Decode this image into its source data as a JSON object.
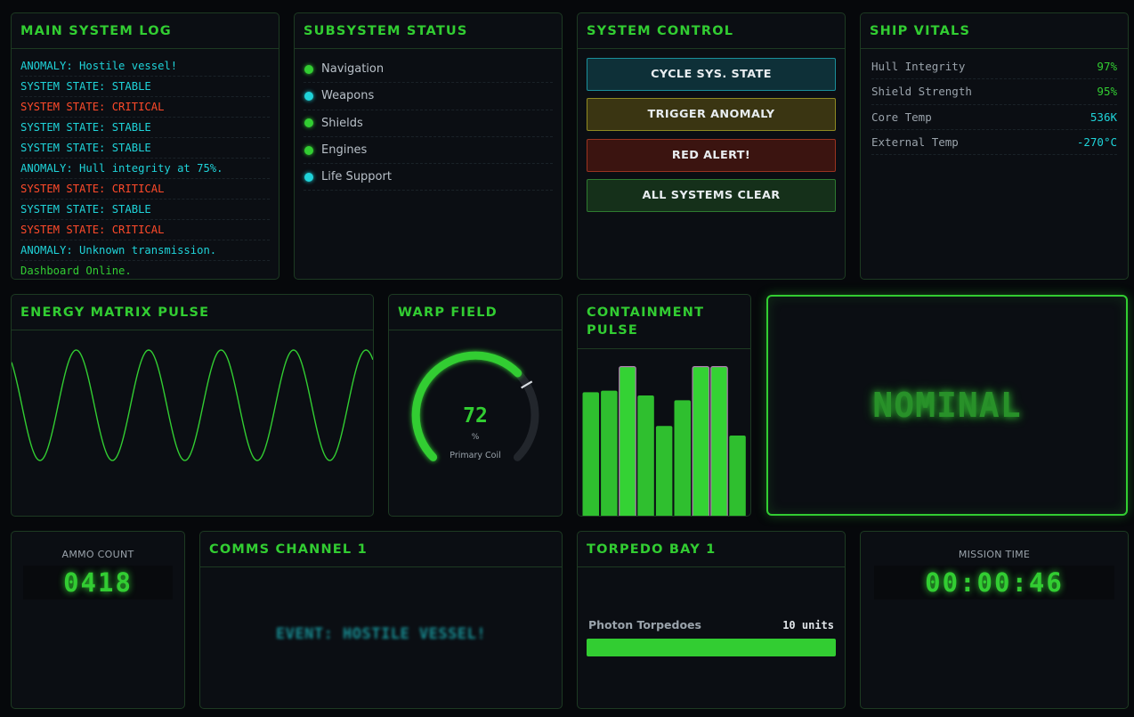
{
  "colors": {
    "accent": "#32cd32",
    "cyan": "#1fd3d9",
    "critical": "#ff4a2a"
  },
  "log": {
    "title": "MAIN SYSTEM LOG",
    "lines": [
      {
        "text": "ANOMALY: Hostile vessel!",
        "tone": "cyan"
      },
      {
        "text": "SYSTEM STATE: STABLE",
        "tone": "cyan"
      },
      {
        "text": "SYSTEM STATE: CRITICAL",
        "tone": "red"
      },
      {
        "text": "SYSTEM STATE: STABLE",
        "tone": "cyan"
      },
      {
        "text": "SYSTEM STATE: STABLE",
        "tone": "cyan"
      },
      {
        "text": "ANOMALY: Hull integrity at 75%.",
        "tone": "cyan"
      },
      {
        "text": "SYSTEM STATE: CRITICAL",
        "tone": "red"
      },
      {
        "text": "SYSTEM STATE: STABLE",
        "tone": "cyan"
      },
      {
        "text": "SYSTEM STATE: CRITICAL",
        "tone": "red"
      },
      {
        "text": "ANOMALY: Unknown transmission.",
        "tone": "cyan"
      },
      {
        "text": "Dashboard Online.",
        "tone": "green"
      }
    ]
  },
  "subsystems": {
    "title": "SUBSYSTEM STATUS",
    "items": [
      {
        "label": "Navigation",
        "status": "green"
      },
      {
        "label": "Weapons",
        "status": "cyan"
      },
      {
        "label": "Shields",
        "status": "green"
      },
      {
        "label": "Engines",
        "status": "green"
      },
      {
        "label": "Life Support",
        "status": "cyan"
      }
    ]
  },
  "control": {
    "title": "SYSTEM CONTROL",
    "cycle": "CYCLE SYS. STATE",
    "anomaly": "TRIGGER ANOMALY",
    "red_alert": "RED ALERT!",
    "clear": "ALL SYSTEMS CLEAR"
  },
  "vitals": {
    "title": "SHIP VITALS",
    "rows": [
      {
        "label": "Hull Integrity",
        "value": "97%",
        "tone": "green"
      },
      {
        "label": "Shield Strength",
        "value": "95%",
        "tone": "green"
      },
      {
        "label": "Core Temp",
        "value": "536K",
        "tone": "cyan"
      },
      {
        "label": "External Temp",
        "value": "-270°C",
        "tone": "cyan"
      }
    ]
  },
  "energy": {
    "title": "ENERGY MATRIX PULSE",
    "cycles": 5
  },
  "warp": {
    "title": "WARP FIELD",
    "value": "72",
    "level": 72,
    "unit": "%",
    "label": "Primary Coil"
  },
  "containment": {
    "title_line1": "CONTAINMENT",
    "title_line2": "PULSE",
    "levels": [
      0.77,
      0.78,
      0.93,
      0.75,
      0.56,
      0.72,
      0.93,
      0.93,
      0.5
    ],
    "highlighted": [
      2,
      6,
      7
    ]
  },
  "status": {
    "text": "NOMINAL"
  },
  "ammo": {
    "label": "AMMO COUNT",
    "value": "0418"
  },
  "comms": {
    "title": "COMMS CHANNEL 1",
    "message": "EVENT: HOSTILE VESSEL!"
  },
  "torpedo": {
    "title": "TORPEDO BAY 1",
    "label": "Photon Torpedoes",
    "count": "10 units",
    "fill_fraction": 1.0
  },
  "mission": {
    "label": "MISSION TIME",
    "value": "00:00:46"
  }
}
